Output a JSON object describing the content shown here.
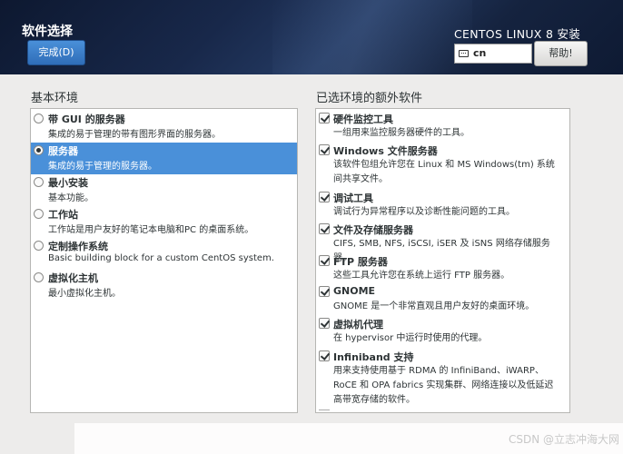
{
  "header": {
    "title": "软件选择",
    "done_label": "完成(D)",
    "product": "CENTOS LINUX 8 安装",
    "keyboard_layout": "cn",
    "help_label": "帮助!"
  },
  "base_env": {
    "title": "基本环境",
    "items": [
      {
        "title": "带 GUI 的服务器",
        "desc": "集成的易于管理的带有图形界面的服务器。",
        "selected": false
      },
      {
        "title": "服务器",
        "desc": "集成的易于管理的服务器。",
        "selected": true
      },
      {
        "title": "最小安装",
        "desc": "基本功能。",
        "selected": false
      },
      {
        "title": "工作站",
        "desc": "工作站是用户友好的笔记本电脑和PC 的桌面系统。",
        "selected": false
      },
      {
        "title": "定制操作系统",
        "desc": "Basic building block for a custom CentOS system.",
        "selected": false
      },
      {
        "title": "虚拟化主机",
        "desc": "最小虚拟化主机。",
        "selected": false
      }
    ]
  },
  "addons": {
    "title": "已选环境的额外软件",
    "items": [
      {
        "title": "硬件监控工具",
        "desc": "一组用来监控服务器硬件的工具。",
        "checked": true
      },
      {
        "title": "Windows 文件服务器",
        "desc": "该软件包组允许您在 Linux 和 MS Windows(tm) 系统间共享文件。",
        "checked": true
      },
      {
        "title": "调试工具",
        "desc": "调试行为异常程序以及诊断性能问题的工具。",
        "checked": true
      },
      {
        "title": "文件及存储服务器",
        "desc": "CIFS, SMB, NFS, iSCSI, iSER 及 iSNS 网络存储服务器。",
        "checked": true
      },
      {
        "title": "FTP 服务器",
        "desc": "这些工具允许您在系统上运行 FTP 服务器。",
        "checked": true
      },
      {
        "title": "GNOME",
        "desc": "GNOME 是一个非常直观且用户友好的桌面环境。",
        "checked": true
      },
      {
        "title": "虚拟机代理",
        "desc": "在 hypervisor 中运行时使用的代理。",
        "checked": true
      },
      {
        "title": "Infiniband 支持",
        "desc": "用来支持使用基于 RDMA 的 InfiniBand、iWARP、RoCE 和 OPA fabrics 实现集群、网络连接以及低延迟高带宽存储的软件。",
        "checked": true
      }
    ]
  },
  "watermark": "CSDN @立志冲海大网"
}
